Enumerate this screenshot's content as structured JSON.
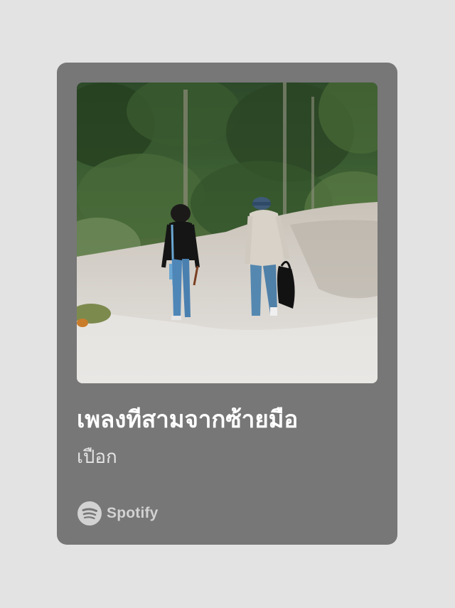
{
  "card": {
    "title": "เพลงทีสามจากซ้ายมือ",
    "artist": "เปือก",
    "brand": "Spotify",
    "cover_description_icon": "album-cover-image",
    "colors": {
      "page_background": "#e3e3e3",
      "card_background": "#777777",
      "title_color": "#ffffff",
      "artist_color": "#e4e4e4",
      "brand_color": "#d2d2d2"
    }
  }
}
